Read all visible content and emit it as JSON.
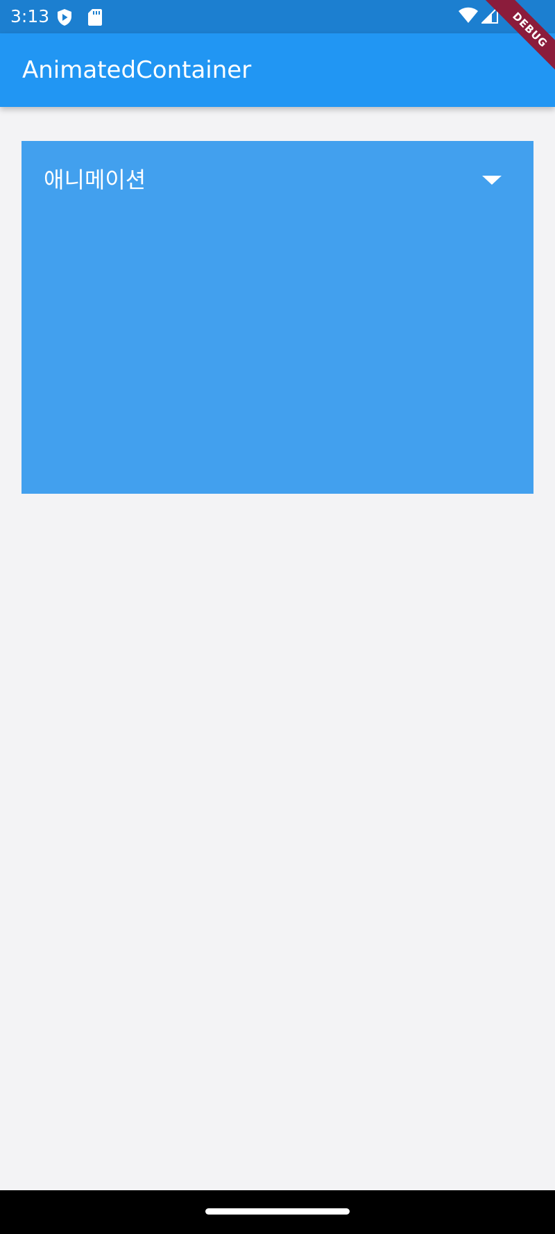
{
  "status_bar": {
    "time": "3:13",
    "icons": [
      "shield-play-icon",
      "sd-card-icon",
      "wifi-icon",
      "signal-icon"
    ]
  },
  "app_bar": {
    "title": "AnimatedContainer"
  },
  "debug_banner": {
    "label": "DEBUG",
    "color": "#8b1c3b"
  },
  "animated_container": {
    "label": "애니메이션",
    "icon": "arrow-drop-down-icon",
    "color": "#42a0ee"
  },
  "colors": {
    "primary": "#2196f3",
    "status_bar": "#1c7fd0",
    "background": "#f3f3f5"
  }
}
